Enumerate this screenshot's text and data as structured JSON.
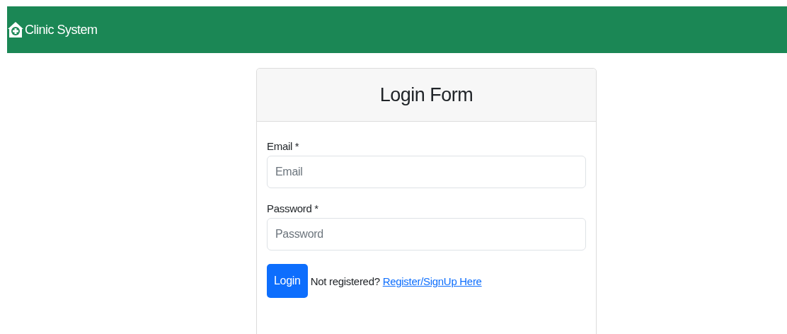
{
  "navbar": {
    "brand": "Clinic System"
  },
  "form": {
    "title": "Login Form",
    "fields": [
      {
        "label": "Email *",
        "placeholder": "Email"
      },
      {
        "label": "Password *",
        "placeholder": "Password"
      }
    ],
    "submit": "Login",
    "prompt": "Not registered?",
    "link": "Register/SignUp Here"
  }
}
